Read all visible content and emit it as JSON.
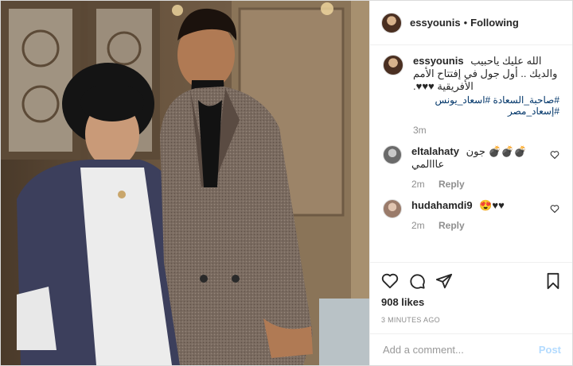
{
  "post": {
    "username": "essyounis",
    "follow_status": "Following",
    "dot": "•",
    "caption": {
      "username": "essyounis",
      "text": "الله عليك ياحبيب والديك .. أول جول في إفتتاح الأمم الأفريقية ♥♥♥.",
      "hashtags": "#صاحبة_السعادة #اسعاد_يونس #إسعاد_مصر",
      "age": "3m"
    },
    "comments": [
      {
        "username": "eltalahaty",
        "text": "💣💣💣 جون عااالمي",
        "age": "2m",
        "reply": "Reply"
      },
      {
        "username": "hudahamdi9",
        "text": "😍♥♥",
        "age": "2m",
        "reply": "Reply"
      }
    ],
    "likes": "908 likes",
    "timestamp": "3 MINUTES AGO",
    "add_comment_placeholder": "Add a comment...",
    "post_label": "Post"
  },
  "colors": {
    "link": "#003569",
    "post_disabled": "#b3dbff",
    "muted": "#8e8e8e"
  },
  "icons": [
    "heart-icon",
    "comment-icon",
    "share-icon",
    "bookmark-icon"
  ]
}
